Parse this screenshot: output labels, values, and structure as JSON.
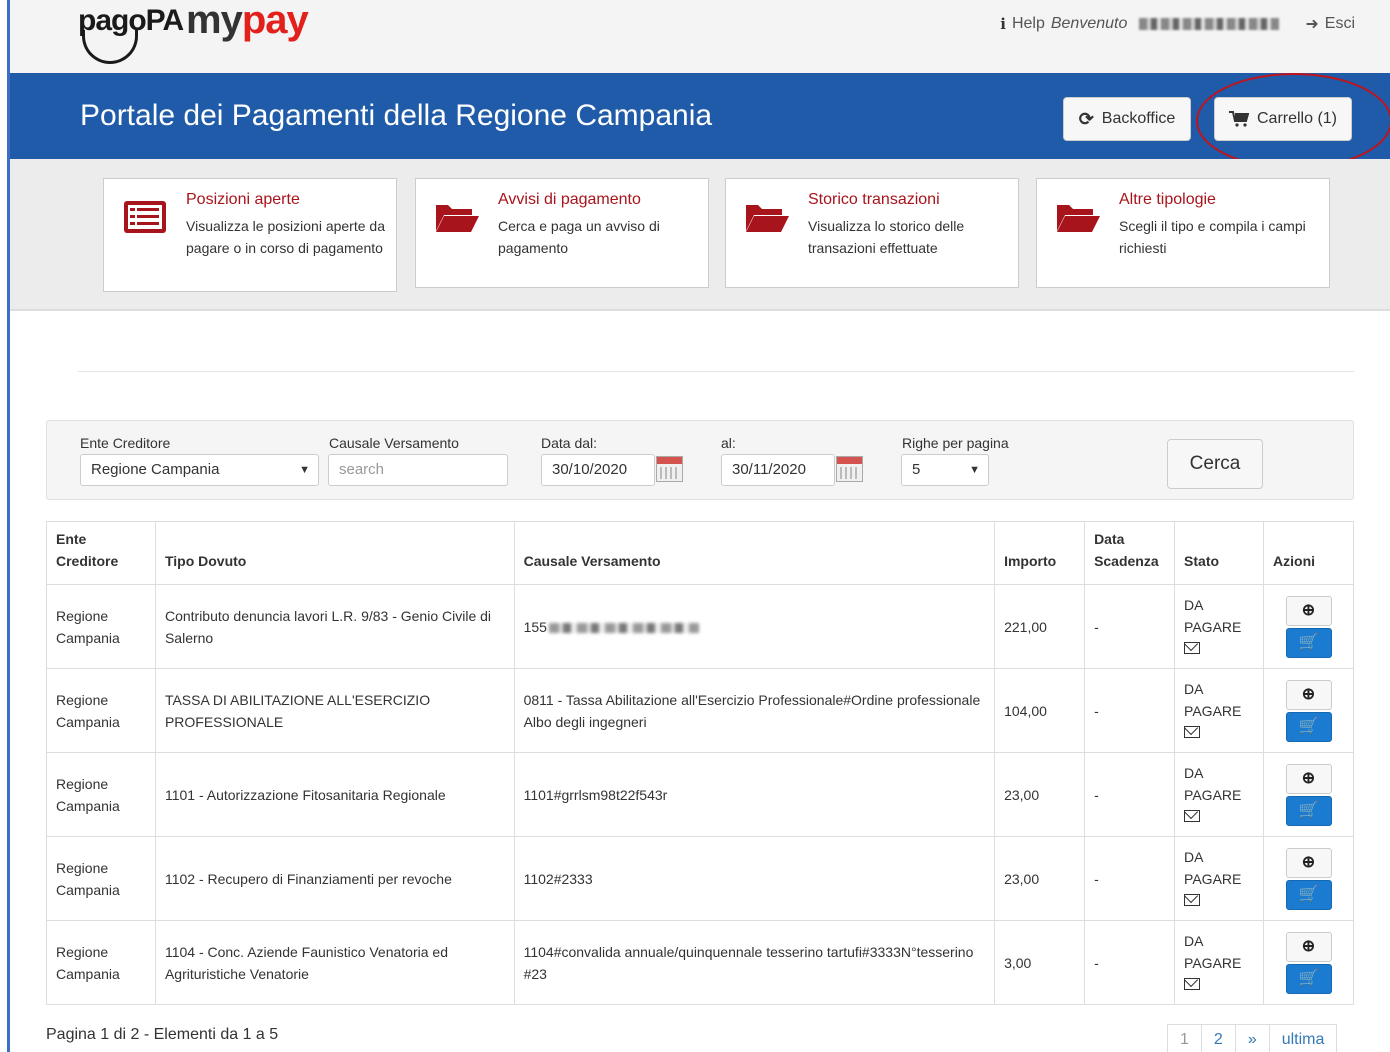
{
  "topbar": {
    "logo_pagopa": "pagoPA",
    "logo_my": "my",
    "logo_pay": "pay",
    "help_label": "Help",
    "welcome_label": "Benvenuto",
    "exit_label": "Esci"
  },
  "header": {
    "title": "Portale dei Pagamenti della Regione Campania",
    "backoffice_label": "Backoffice",
    "cart_label": "Carrello (1)"
  },
  "cards": [
    {
      "title": "Posizioni aperte",
      "desc": "Visualizza le posizioni aperte da pagare o in corso di pagamento",
      "icon": "list-icon"
    },
    {
      "title": "Avvisi di pagamento",
      "desc": "Cerca e paga un avviso di pagamento",
      "icon": "folder-open-icon"
    },
    {
      "title": "Storico transazioni",
      "desc": "Visualizza lo storico delle transazioni effettuate",
      "icon": "folder-open-icon"
    },
    {
      "title": "Altre tipologie",
      "desc": "Scegli il tipo e compila i campi richiesti",
      "icon": "folder-open-icon"
    }
  ],
  "filter": {
    "ente_label": "Ente Creditore",
    "ente_value": "Regione Campania",
    "causale_label": "Causale Versamento",
    "causale_placeholder": "search",
    "data_dal_label": "Data dal:",
    "data_dal_value": "30/10/2020",
    "al_label": "al:",
    "al_value": "30/11/2020",
    "righe_label": "Righe per pagina",
    "righe_value": "5",
    "cerca_label": "Cerca"
  },
  "table": {
    "headers": {
      "ente_line1": "Ente",
      "ente_line2": "Creditore",
      "tipo": "Tipo Dovuto",
      "causale": "Causale Versamento",
      "importo": "Importo",
      "scadenza_line1": "Data",
      "scadenza_line2": "Scadenza",
      "stato": "Stato",
      "azioni": "Azioni"
    },
    "rows": [
      {
        "ente_line1": "Regione",
        "ente_line2": "Campania",
        "tipo": "Contributo denuncia lavori L.R. 9/83 - Genio Civile di Salerno",
        "causale": "155",
        "importo": "221,00",
        "scadenza": "-",
        "stato_line1": "DA",
        "stato_line2": "PAGARE"
      },
      {
        "ente_line1": "Regione",
        "ente_line2": "Campania",
        "tipo": "TASSA DI ABILITAZIONE ALL'ESERCIZIO PROFESSIONALE",
        "causale": "0811 - Tassa Abilitazione all'Esercizio Professionale#Ordine professionale Albo degli ingegneri",
        "importo": "104,00",
        "scadenza": "-",
        "stato_line1": "DA",
        "stato_line2": "PAGARE"
      },
      {
        "ente_line1": "Regione",
        "ente_line2": "Campania",
        "tipo": "1101 - Autorizzazione Fitosanitaria Regionale",
        "causale": "1101#grrlsm98t22f543r",
        "importo": "23,00",
        "scadenza": "-",
        "stato_line1": "DA",
        "stato_line2": "PAGARE"
      },
      {
        "ente_line1": "Regione",
        "ente_line2": "Campania",
        "tipo": "1102 - Recupero di Finanziamenti per revoche",
        "causale": "1102#2333",
        "importo": "23,00",
        "scadenza": "-",
        "stato_line1": "DA",
        "stato_line2": "PAGARE"
      },
      {
        "ente_line1": "Regione",
        "ente_line2": "Campania",
        "tipo": "1104 - Conc. Aziende Faunistico Venatoria ed Agrituristiche Venatorie",
        "causale": "1104#convalida annuale/quinquennale tesserino tartufi#3333N°tesserino #23",
        "importo": "3,00",
        "scadenza": "-",
        "stato_line1": "DA",
        "stato_line2": "PAGARE"
      }
    ]
  },
  "pagination": {
    "info": "Pagina 1 di 2 - Elementi da 1 a 5",
    "pages": [
      "1",
      "2"
    ],
    "next_label": "»",
    "last_label": "ultima"
  },
  "colors": {
    "header_blue": "#1f5ba8",
    "accent_red": "#a8141c",
    "cart_blue": "#1a7bd0"
  }
}
